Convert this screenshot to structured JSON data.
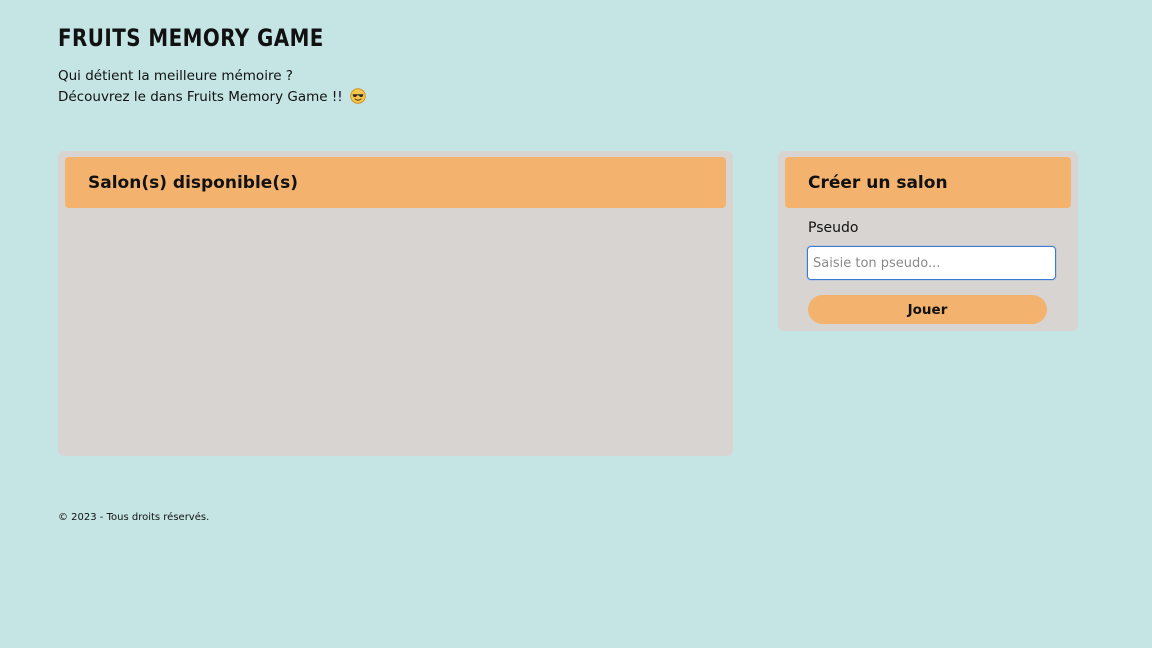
{
  "header": {
    "title": "FRUITS MEMORY GAME",
    "tagline_line1": "Qui détient la meilleure mémoire ?",
    "tagline_line2": "Découvrez le dans Fruits Memory Game !!",
    "tagline_emoji": "smiling-face-with-sunglasses-icon"
  },
  "rooms_panel": {
    "title": "Salon(s) disponible(s)",
    "rooms": []
  },
  "create_panel": {
    "title": "Créer un salon",
    "pseudo_label": "Pseudo",
    "pseudo_placeholder": "Saisie ton pseudo...",
    "pseudo_value": "",
    "play_label": "Jouer"
  },
  "footer": {
    "copyright": "© 2023 - Tous droits réservés."
  },
  "colors": {
    "background": "#c5e5e5",
    "panel": "#d8d4d2",
    "accent": "#f3b36f",
    "input_focus": "#3a7bd5"
  }
}
